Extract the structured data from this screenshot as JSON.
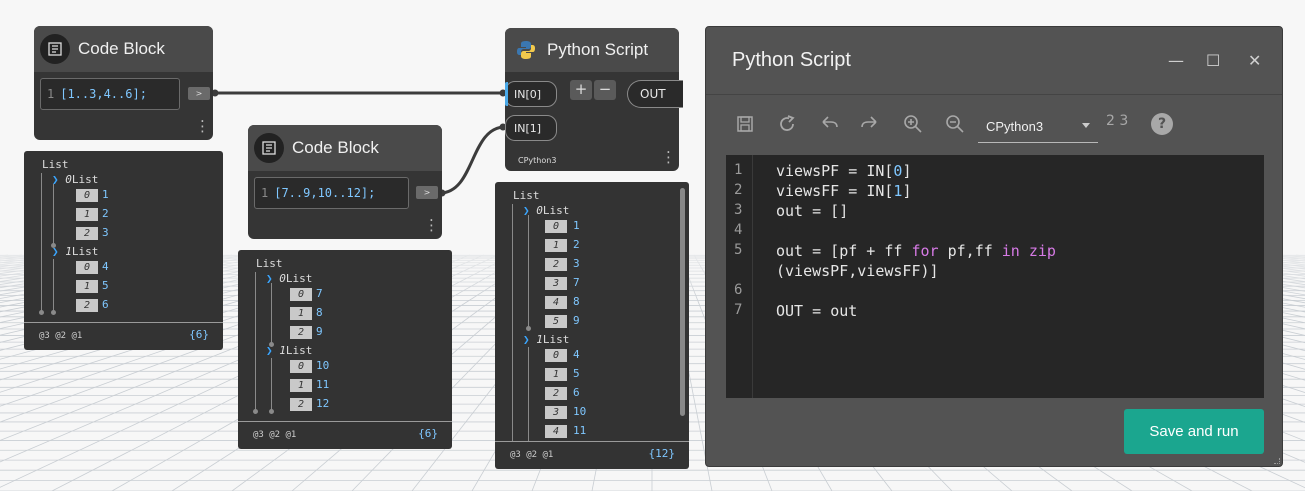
{
  "nodes": {
    "code_block_1": {
      "title": "Code Block",
      "line_number": "1",
      "code": "[1..3,4..6];",
      "out_port": ">",
      "menu": "⋮"
    },
    "code_block_2": {
      "title": "Code Block",
      "line_number": "1",
      "code": "[7..9,10..12];",
      "out_port": ">",
      "menu": "⋮"
    },
    "python_node": {
      "title": "Python Script",
      "inputs": [
        "IN[0]",
        "IN[1]"
      ],
      "add_label": "+",
      "remove_label": "−",
      "output": "OUT",
      "engine": "CPython3",
      "menu": "⋮"
    }
  },
  "previews": {
    "preview_1": {
      "root": "List",
      "groups": [
        {
          "index": "0",
          "label": "List",
          "items": [
            {
              "i": "0",
              "v": "1"
            },
            {
              "i": "1",
              "v": "2"
            },
            {
              "i": "2",
              "v": "3"
            }
          ]
        },
        {
          "index": "1",
          "label": "List",
          "items": [
            {
              "i": "0",
              "v": "4"
            },
            {
              "i": "1",
              "v": "5"
            },
            {
              "i": "2",
              "v": "6"
            }
          ]
        }
      ],
      "levels": "@3 @2 @1",
      "count": "{6}"
    },
    "preview_2": {
      "root": "List",
      "groups": [
        {
          "index": "0",
          "label": "List",
          "items": [
            {
              "i": "0",
              "v": "7"
            },
            {
              "i": "1",
              "v": "8"
            },
            {
              "i": "2",
              "v": "9"
            }
          ]
        },
        {
          "index": "1",
          "label": "List",
          "items": [
            {
              "i": "0",
              "v": "10"
            },
            {
              "i": "1",
              "v": "11"
            },
            {
              "i": "2",
              "v": "12"
            }
          ]
        }
      ],
      "levels": "@3 @2 @1",
      "count": "{6}"
    },
    "preview_3": {
      "root": "List",
      "groups": [
        {
          "index": "0",
          "label": "List",
          "items": [
            {
              "i": "0",
              "v": "1"
            },
            {
              "i": "1",
              "v": "2"
            },
            {
              "i": "2",
              "v": "3"
            },
            {
              "i": "3",
              "v": "7"
            },
            {
              "i": "4",
              "v": "8"
            },
            {
              "i": "5",
              "v": "9"
            }
          ]
        },
        {
          "index": "1",
          "label": "List",
          "items": [
            {
              "i": "0",
              "v": "4"
            },
            {
              "i": "1",
              "v": "5"
            },
            {
              "i": "2",
              "v": "6"
            },
            {
              "i": "3",
              "v": "10"
            },
            {
              "i": "4",
              "v": "11"
            }
          ]
        }
      ],
      "levels": "@3 @2 @1",
      "count": "{12}"
    }
  },
  "editor_window": {
    "title": "Python Script",
    "minimize": "—",
    "maximize": "☐",
    "close": "✕",
    "engine": "CPython3",
    "migrate_label": "2 3",
    "help": "?",
    "line_numbers": [
      "1",
      "2",
      "3",
      "4",
      "5",
      "",
      "6",
      "7"
    ],
    "code_lines": [
      "viewsPF = IN[0]",
      "viewsFF = IN[1]",
      "out = []",
      "",
      "out = [pf + ff for pf,ff in zip",
      "(viewsPF,viewsFF)]",
      "",
      "OUT = out"
    ],
    "save_run_label": "Save and run"
  },
  "colors": {
    "accent_blue": "#4aa9e8",
    "value_blue": "#7fc7ff",
    "run_button": "#1ba68f",
    "keyword": "#d77ae6"
  }
}
